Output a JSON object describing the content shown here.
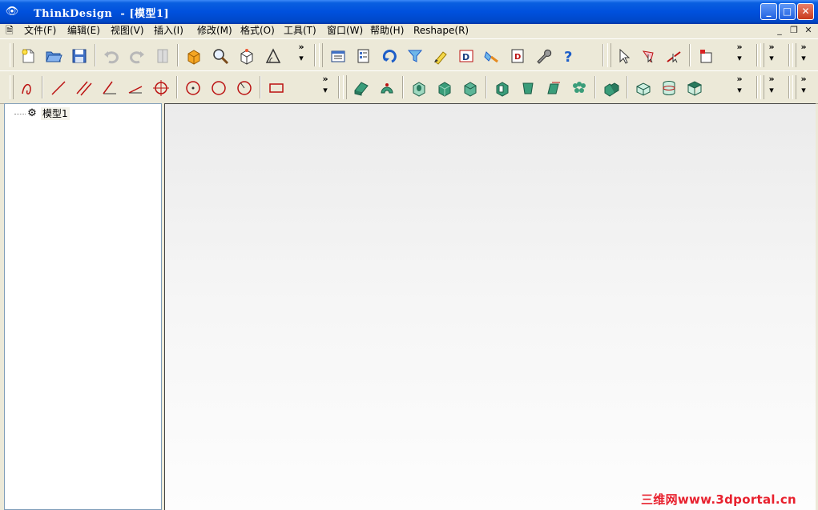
{
  "window": {
    "title": "ThinkDesign  - [模型1]",
    "min_label": "_",
    "max_label": "□",
    "close_label": "✕"
  },
  "menubar": {
    "items": [
      {
        "label": "文件(F)"
      },
      {
        "label": "编辑(E)"
      },
      {
        "label": "视图(V)"
      },
      {
        "label": "插入(I)"
      },
      {
        "label": "修改(M)"
      },
      {
        "label": "格式(O)"
      },
      {
        "label": "工具(T)"
      },
      {
        "label": "窗口(W)"
      },
      {
        "label": "帮助(H)"
      },
      {
        "label": "Reshape(R)"
      }
    ],
    "mdi_min": "_",
    "mdi_restore": "❐",
    "mdi_close": "✕"
  },
  "toolbar": {
    "chevron": "»"
  },
  "tree": {
    "root_label": "模型1"
  },
  "watermark": "三维网www.3dportal.cn"
}
